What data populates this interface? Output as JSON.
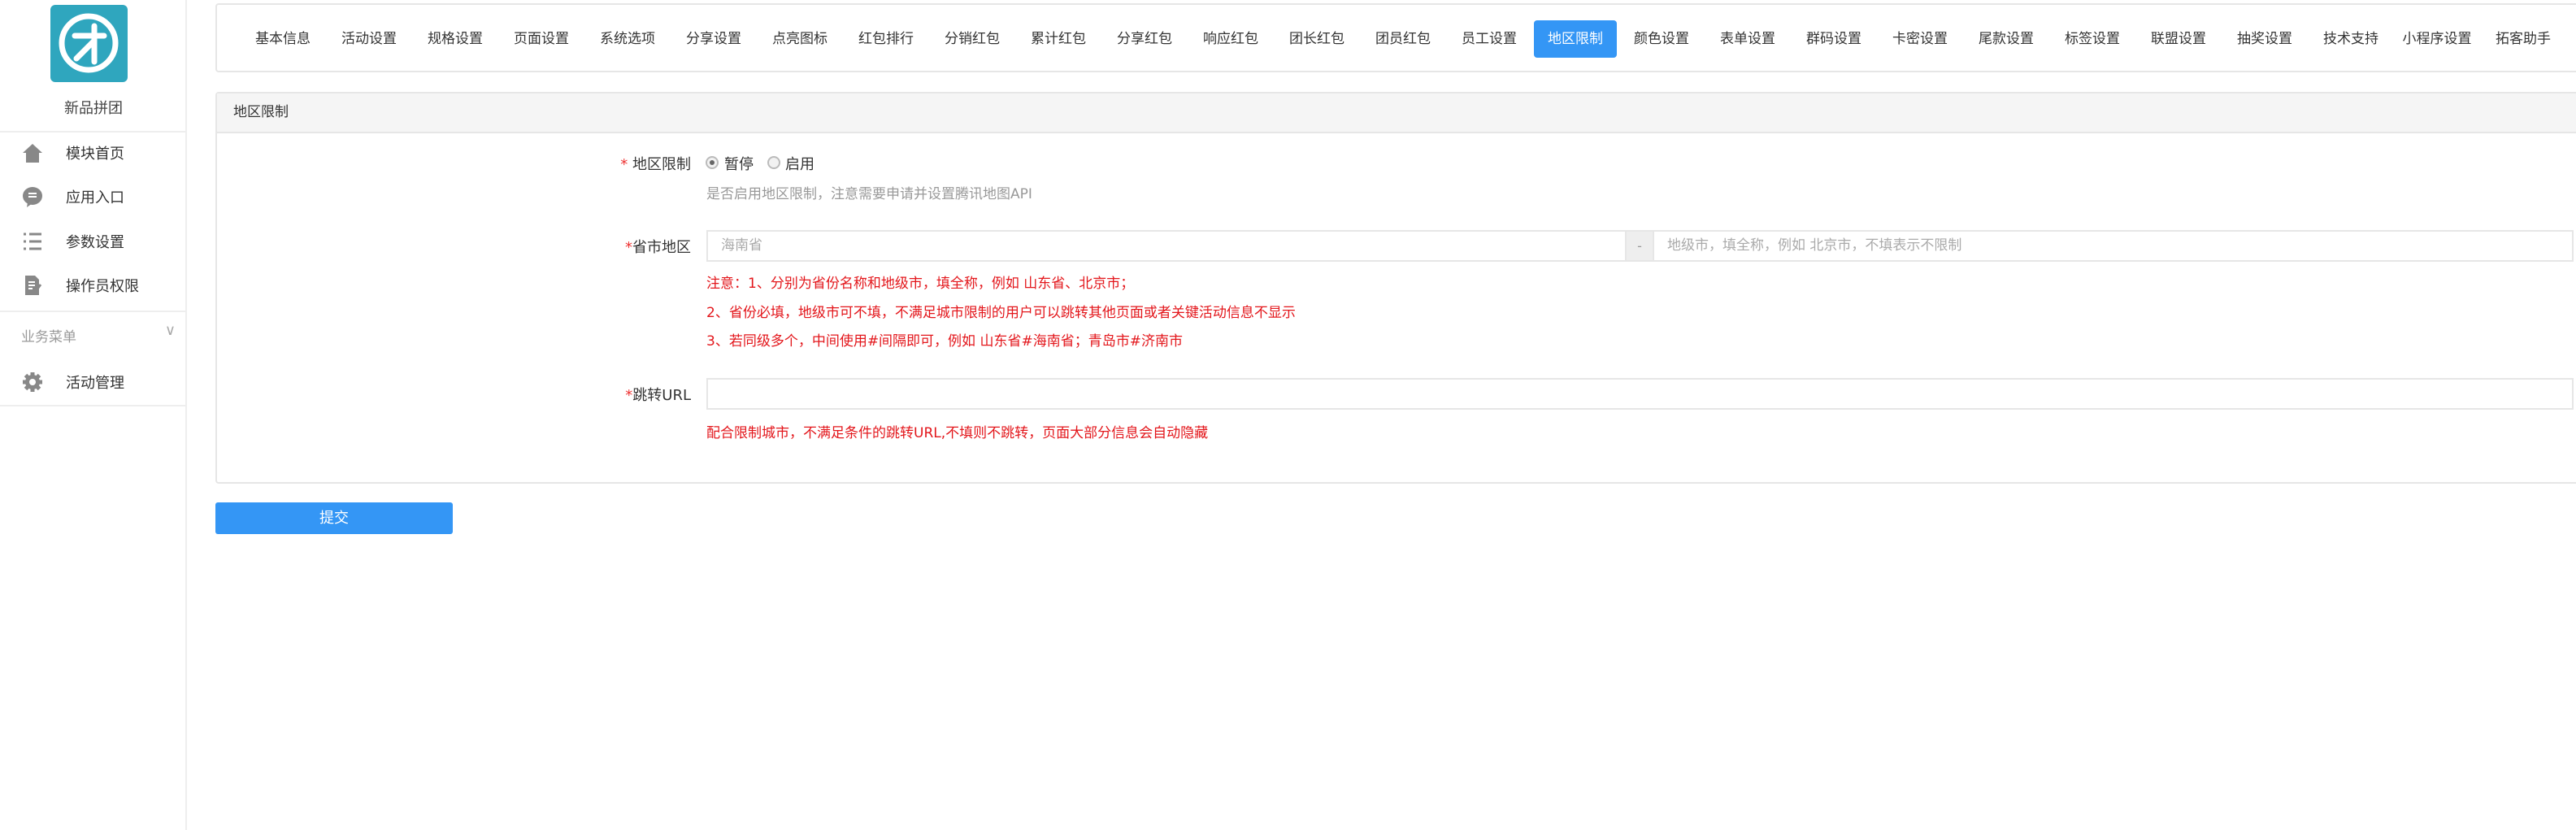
{
  "sidebar": {
    "app_name": "新品拼团",
    "items": [
      {
        "label": "模块首页",
        "icon": "home-icon"
      },
      {
        "label": "应用入口",
        "icon": "chat-icon"
      },
      {
        "label": "参数设置",
        "icon": "list-icon"
      },
      {
        "label": "操作员权限",
        "icon": "document-edit-icon"
      }
    ],
    "group_label": "业务菜单",
    "group_items": [
      {
        "label": "活动管理",
        "icon": "gear-icon"
      }
    ]
  },
  "tabs": [
    "基本信息",
    "活动设置",
    "规格设置",
    "页面设置",
    "系统选项",
    "分享设置",
    "点亮图标",
    "红包排行",
    "分销红包",
    "累计红包",
    "分享红包",
    "响应红包",
    "团长红包",
    "团员红包",
    "员工设置",
    "地区限制",
    "颜色设置",
    "表单设置",
    "群码设置",
    "卡密设置",
    "尾款设置",
    "标签设置",
    "联盟设置",
    "抽奖设置",
    "技术支持",
    "小程序设置",
    "拓客助手"
  ],
  "active_tab": "地区限制",
  "panel": {
    "title": "地区限制",
    "region_limit": {
      "label": "地区限制",
      "options": [
        "暂停",
        "启用"
      ],
      "selected": "暂停",
      "help": "是否启用地区限制，注意需要申请并设置腾讯地图API"
    },
    "province": {
      "label": "省市地区",
      "province_placeholder": "海南省",
      "separator": "-",
      "city_placeholder": "地级市，填全称，例如 北京市，不填表示不限制",
      "notes": [
        "注意：1、分别为省份名称和地级市，填全称，例如 山东省、北京市；",
        "2、省份必填，地级市可不填，不满足城市限制的用户可以跳转其他页面或者关键活动信息不显示",
        "3、若同级多个，中间使用#间隔即可，例如 山东省#海南省；青岛市#济南市"
      ]
    },
    "redirect": {
      "label": "跳转URL",
      "value": "",
      "note": "配合限制城市，不满足条件的跳转URL,不填则不跳转，页面大部分信息会自动隐藏"
    }
  },
  "submit_label": "提交",
  "colors": {
    "accent": "#3496f5",
    "note": "#e3161b",
    "logo": "#2fa6be"
  }
}
